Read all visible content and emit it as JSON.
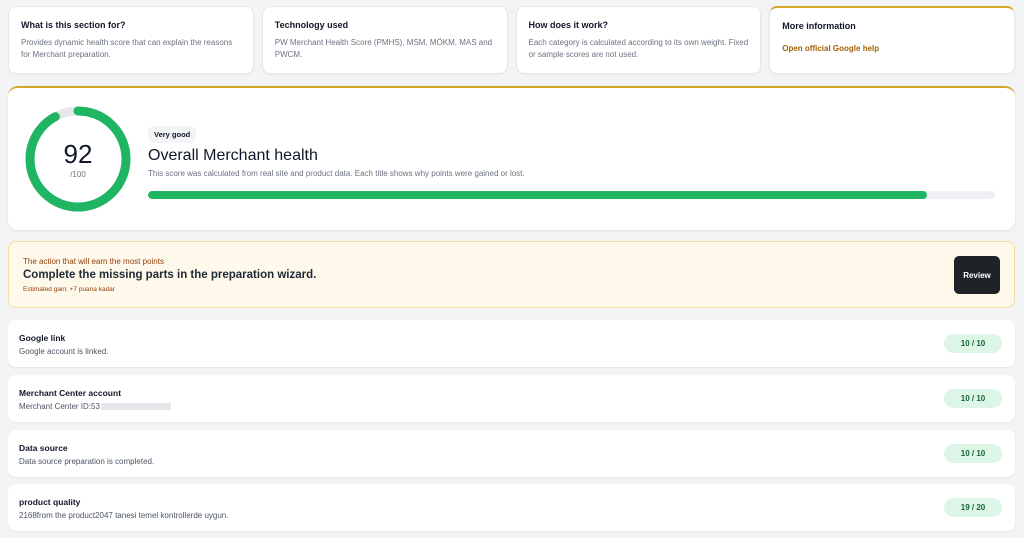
{
  "info_cards": [
    {
      "title": "What is this section for?",
      "text": "Provides dynamic health score that can explain the reasons for Merchant preparation."
    },
    {
      "title": "Technology used",
      "text": "PW Merchant Health Score (PMHS), MSM, MÖKM, MAS and PWCM."
    },
    {
      "title": "How does it work?",
      "text": "Each category is calculated according to its own weight. Fixed or sample scores are not used."
    },
    {
      "title": "More information",
      "link": "Open official Google help"
    }
  ],
  "score": {
    "value": "92",
    "max": "/100",
    "fraction": 0.92,
    "badge": "Very good",
    "title": "Overall Merchant health",
    "subtitle": "This score was calculated from real site and product data. Each title shows why points were gained or lost.",
    "color": "#1fb563"
  },
  "action": {
    "pre": "The action that will earn the most points",
    "title": "Complete the missing parts in the preparation wizard.",
    "gain": "Estimated gain: +7 puana kadar",
    "button": "Review"
  },
  "checks": [
    {
      "title": "Google link",
      "desc": "Google account is linked.",
      "score": "10 / 10"
    },
    {
      "title": "Merchant Center account",
      "desc": "Merchant Center ID:53",
      "score": "10 / 10"
    },
    {
      "title": "Data source",
      "desc": "Data source preparation is completed.",
      "score": "10 / 10"
    },
    {
      "title": "product quality",
      "desc": "2168from the product2047 tanesi temel kontrollerde uygun.",
      "score": "19 / 20"
    }
  ]
}
